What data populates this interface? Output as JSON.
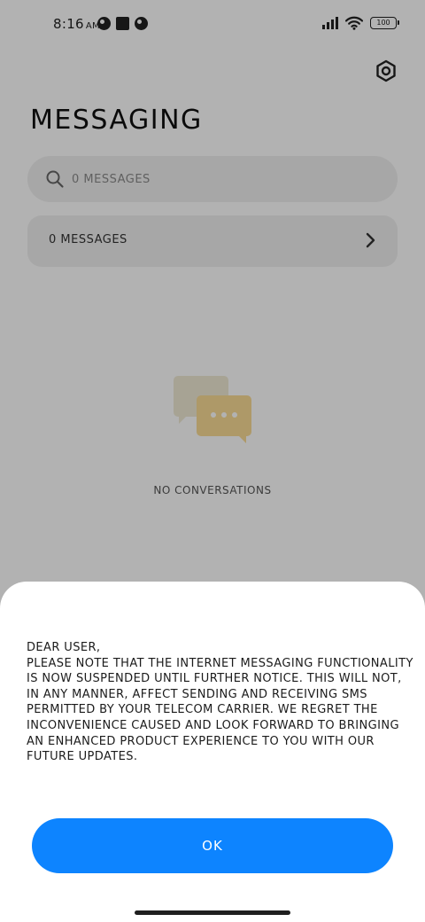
{
  "status_bar": {
    "time": "8:16",
    "time_suffix": "AM",
    "battery": "100"
  },
  "header": {
    "title": "MESSAGING",
    "settings_icon": "gear-icon"
  },
  "search": {
    "placeholder": "0 MESSAGES",
    "icon": "search-icon"
  },
  "messages_row": {
    "label": "0 MESSAGES",
    "icon": "chevron-right-icon"
  },
  "empty_state": {
    "text": "NO CONVERSATIONS",
    "icon": "chat-bubbles-icon",
    "colors": {
      "back_bubble": "#f0ead5",
      "front_bubble": "#fadc95"
    }
  },
  "dialog": {
    "lines": [
      "DEAR USER,",
      "PLEASE NOTE THAT THE INTERNET MESSAGING FUNCTIONALITY IS NOW SUSPENDED UNTIL FURTHER NOTICE. THIS WILL NOT, IN ANY MANNER, AFFECT SENDING AND RECEIVING SMS PERMITTED BY YOUR TELECOM CARRIER. WE REGRET THE INCONVENIENCE CAUSED AND LOOK FORWARD TO BRINGING AN ENHANCED PRODUCT EXPERIENCE TO YOU WITH OUR FUTURE UPDATES."
    ],
    "ok_label": "OK",
    "colors": {
      "button": "#0d84ff",
      "button_text": "#ffffff"
    }
  }
}
